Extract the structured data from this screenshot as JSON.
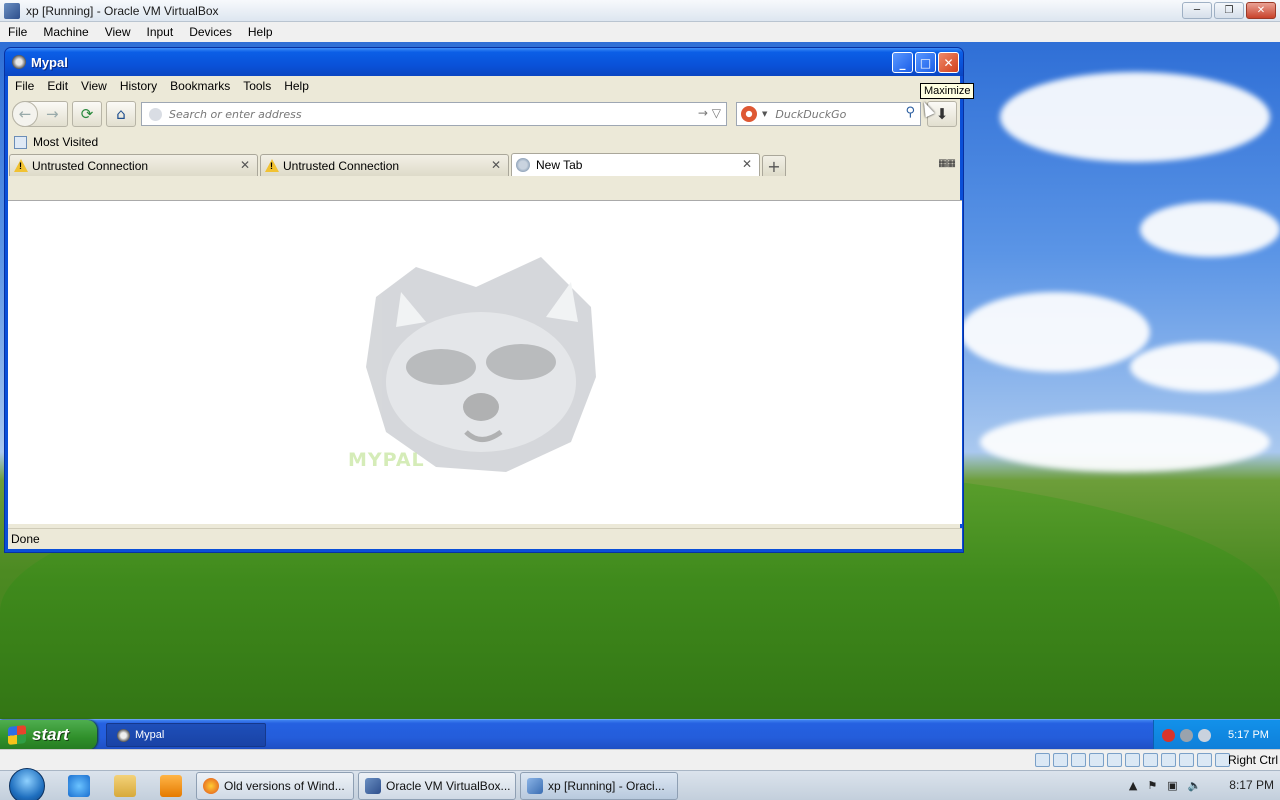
{
  "host_window": {
    "title": "xp [Running] - Oracle VM VirtualBox",
    "menu": [
      "File",
      "Machine",
      "View",
      "Input",
      "Devices",
      "Help"
    ]
  },
  "mypal": {
    "title": "Mypal",
    "menu": [
      "File",
      "Edit",
      "View",
      "History",
      "Bookmarks",
      "Tools",
      "Help"
    ],
    "address_placeholder": "Search or enter address",
    "search_engine": "DuckDuckGo",
    "bookmarks": {
      "most_visited": "Most Visited"
    },
    "tabs": [
      {
        "label": "Untrusted Connection",
        "icon": "warning-icon",
        "active": false
      },
      {
        "label": "Untrusted Connection",
        "icon": "warning-icon",
        "active": false
      },
      {
        "label": "New Tab",
        "icon": "globe-icon",
        "active": true
      }
    ],
    "logo_text": "MYPAL",
    "status": "Done",
    "tooltip": "Maximize"
  },
  "xp_taskbar": {
    "start_label": "start",
    "task_label": "Mypal",
    "clock": "5:17 PM"
  },
  "vbox_status": {
    "host_key": "Right Ctrl"
  },
  "host_taskbar": {
    "tasks": [
      {
        "label": "Old versions of Wind...",
        "icon": "firefox-icon"
      },
      {
        "label": "Oracle VM VirtualBox...",
        "icon": "virtualbox-icon"
      },
      {
        "label": "xp [Running] - Oraci...",
        "icon": "virtualbox-vm-icon"
      }
    ],
    "clock": "8:17 PM"
  },
  "colors": {
    "xp_blue": "#0a52d9",
    "xp_green_start": "#2f8f2a",
    "tooltip_bg": "#ffffe1"
  }
}
